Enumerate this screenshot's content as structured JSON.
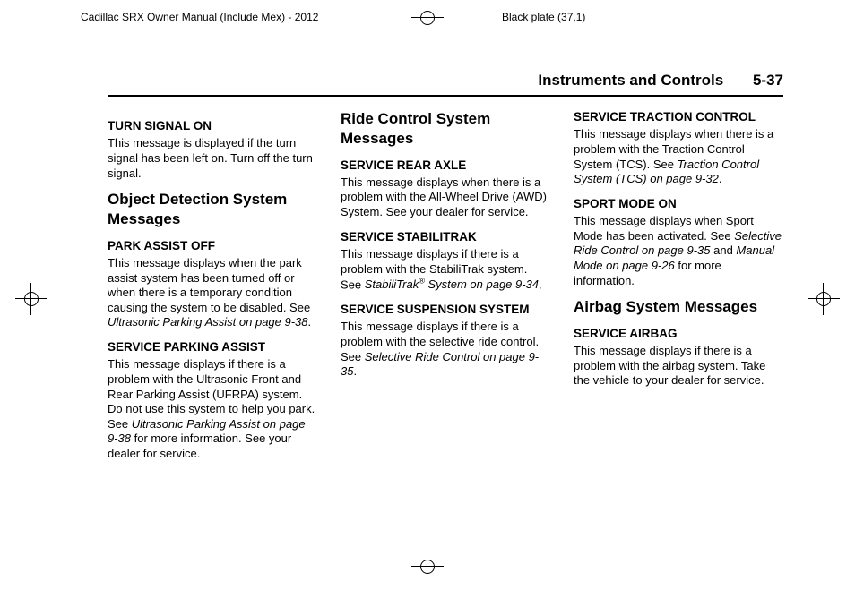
{
  "meta": {
    "manual_title": "Cadillac SRX Owner Manual (Include Mex) - 2012",
    "plate": "Black plate (37,1)"
  },
  "header": {
    "chapter": "Instruments and Controls",
    "page": "5-37"
  },
  "col1": {
    "s1_h": "TURN SIGNAL ON",
    "s1_p": "This message is displayed if the turn signal has been left on. Turn off the turn signal.",
    "s2_title": "Object Detection System Messages",
    "s2a_h": "PARK ASSIST OFF",
    "s2a_p1": "This message displays when the park assist system has been turned off or when there is a temporary condition causing the system to be disabled. See ",
    "s2a_ref": "Ultrasonic Parking Assist on page 9-38",
    "s2a_p2": ".",
    "s2b_h": "SERVICE PARKING ASSIST",
    "s2b_p1": "This message displays if there is a problem with the Ultrasonic Front and Rear Parking Assist (UFRPA) system. Do not use this system to help you park. See ",
    "s2b_ref": "Ultrasonic Parking Assist on page 9-38",
    "s2b_p2": " for more information. See your dealer for service."
  },
  "col2": {
    "title": "Ride Control System Messages",
    "a_h": "SERVICE REAR AXLE",
    "a_p": "This message displays when there is a problem with the All-Wheel Drive (AWD) System. See your dealer for service.",
    "b_h": "SERVICE STABILITRAK",
    "b_p1": "This message displays if there is a problem with the StabiliTrak system. See ",
    "b_ref1": "StabiliTrak",
    "b_sup": "®",
    "b_ref2": " System on page 9-34",
    "b_p2": ".",
    "c_h": "SERVICE SUSPENSION SYSTEM",
    "c_p1": "This message displays if there is a problem with the selective ride control. See ",
    "c_ref": "Selective Ride Control on page 9-35",
    "c_p2": "."
  },
  "col3": {
    "a_h": "SERVICE TRACTION CONTROL",
    "a_p1": "This message displays when there is a problem with the Traction Control System (TCS). See ",
    "a_ref": "Traction Control System (TCS) on page 9-32",
    "a_p2": ".",
    "b_h": "SPORT MODE ON",
    "b_p1": "This message displays when Sport Mode has been activated. See ",
    "b_ref1": "Selective Ride Control on page 9-35",
    "b_mid": " and ",
    "b_ref2": "Manual Mode on page 9-26",
    "b_p2": " for more information.",
    "title": "Airbag System Messages",
    "c_h": "SERVICE AIRBAG",
    "c_p": "This message displays if there is a problem with the airbag system. Take the vehicle to your dealer for service."
  }
}
